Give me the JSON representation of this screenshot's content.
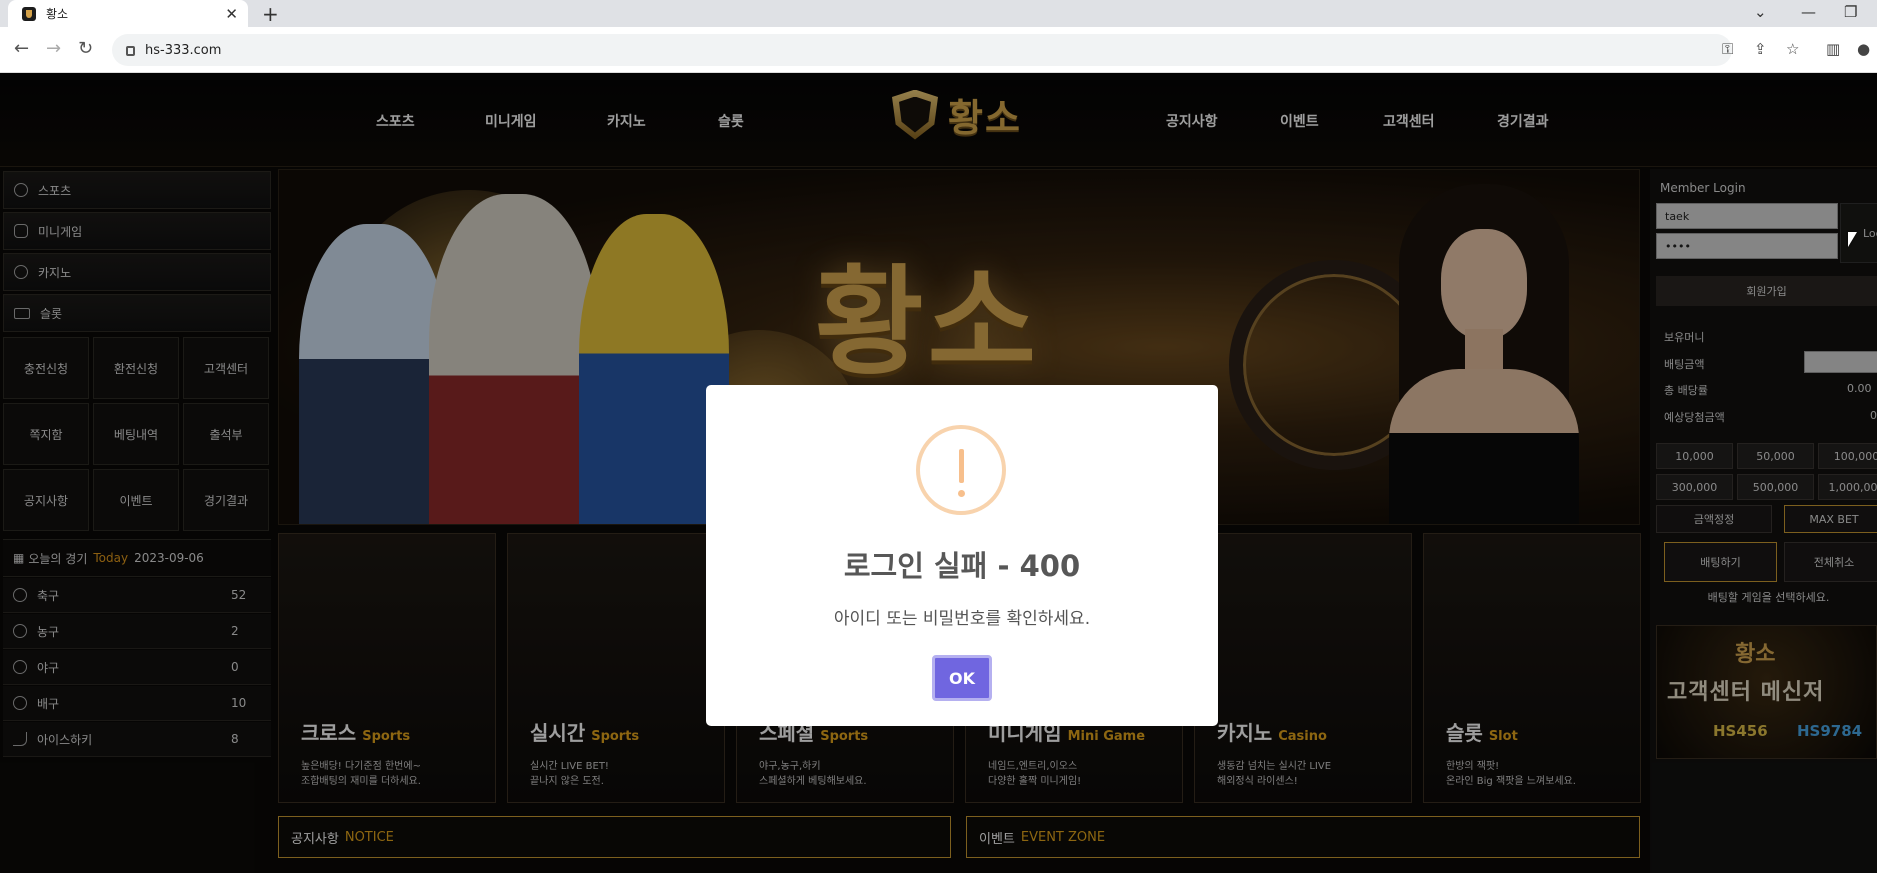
{
  "browser": {
    "tab_title": "황소",
    "tab_close": "✕",
    "new_tab": "+",
    "url": "hs-333.com"
  },
  "site": {
    "logo_text": "황소",
    "nav_left": [
      "스포츠",
      "미니게임",
      "카지노",
      "슬롯"
    ],
    "nav_right": [
      "공지사항",
      "이벤트",
      "고객센터",
      "경기결과"
    ]
  },
  "left_sidebar": {
    "categories": [
      "스포츠",
      "미니게임",
      "카지노",
      "슬롯"
    ],
    "quick_buttons": [
      "충전신청",
      "환전신청",
      "고객센터",
      "쪽지함",
      "베팅내역",
      "출석부",
      "공지사항",
      "이벤트",
      "경기결과"
    ],
    "today_label": "오늘의 경기",
    "today_word": "Today",
    "today_date": "2023-09-06",
    "sports": [
      {
        "name": "축구",
        "count": "52"
      },
      {
        "name": "농구",
        "count": "2"
      },
      {
        "name": "야구",
        "count": "0"
      },
      {
        "name": "배구",
        "count": "10"
      },
      {
        "name": "아이스하키",
        "count": "8"
      }
    ]
  },
  "banner": {
    "title": "황소"
  },
  "cards": [
    {
      "name": "크로스",
      "sub": "Sports",
      "desc": "높은배당! 다기준점 한번에~\n조합배팅의 재미를 더하세요."
    },
    {
      "name": "실시간",
      "sub": "Sports",
      "desc": "실시간 LIVE BET!\n끝나지 않은 도전."
    },
    {
      "name": "스페셜",
      "sub": "Sports",
      "desc": "야구,농구,하키\n스페셜하게 베팅해보세요."
    },
    {
      "name": "미니게임",
      "sub": "Mini Game",
      "desc": "네임드,엔트리,이오스\n다양한 홀짝 미니게임!"
    },
    {
      "name": "카지노",
      "sub": "Casino",
      "desc": "생동감 넘치는 실시간 LIVE\n해외정식 라이센스!"
    },
    {
      "name": "슬롯",
      "sub": "Slot",
      "desc": "한방의 잭팟!\n온라인 Big 잭팟을 느껴보세요."
    }
  ],
  "notice": {
    "label": "공지사항",
    "highlight": "NOTICE"
  },
  "event": {
    "label": "이벤트",
    "highlight": "EVENT ZONE"
  },
  "right_sidebar": {
    "login_title": "Member Login",
    "username_value": "taek",
    "password_value": "••••",
    "login_button": "Log",
    "join_button": "회원가입",
    "balance_label": "보유머니",
    "bet_amount_label": "배팅금액",
    "total_odds_label": "총 배당률",
    "total_odds_value": "0.00",
    "expected_win_label": "예상당첨금액",
    "expected_win_value": "0",
    "amounts": [
      "10,000",
      "50,000",
      "100,000",
      "300,000",
      "500,000",
      "1,000,000"
    ],
    "reset_amount": "금액정정",
    "max_bet": "MAX BET",
    "place_bet": "배팅하기",
    "cancel_all": "전체취소",
    "hint": "배팅할 게임을 선택하세요.",
    "messenger_logo": "황소",
    "messenger_title": "고객센터 메신저",
    "kakao_id": "HS456",
    "telegram_id": "HS9784"
  },
  "modal": {
    "title": "로그인 실패 - 400",
    "message": "아이디 또는 비밀번호를 확인하세요.",
    "ok": "OK"
  }
}
